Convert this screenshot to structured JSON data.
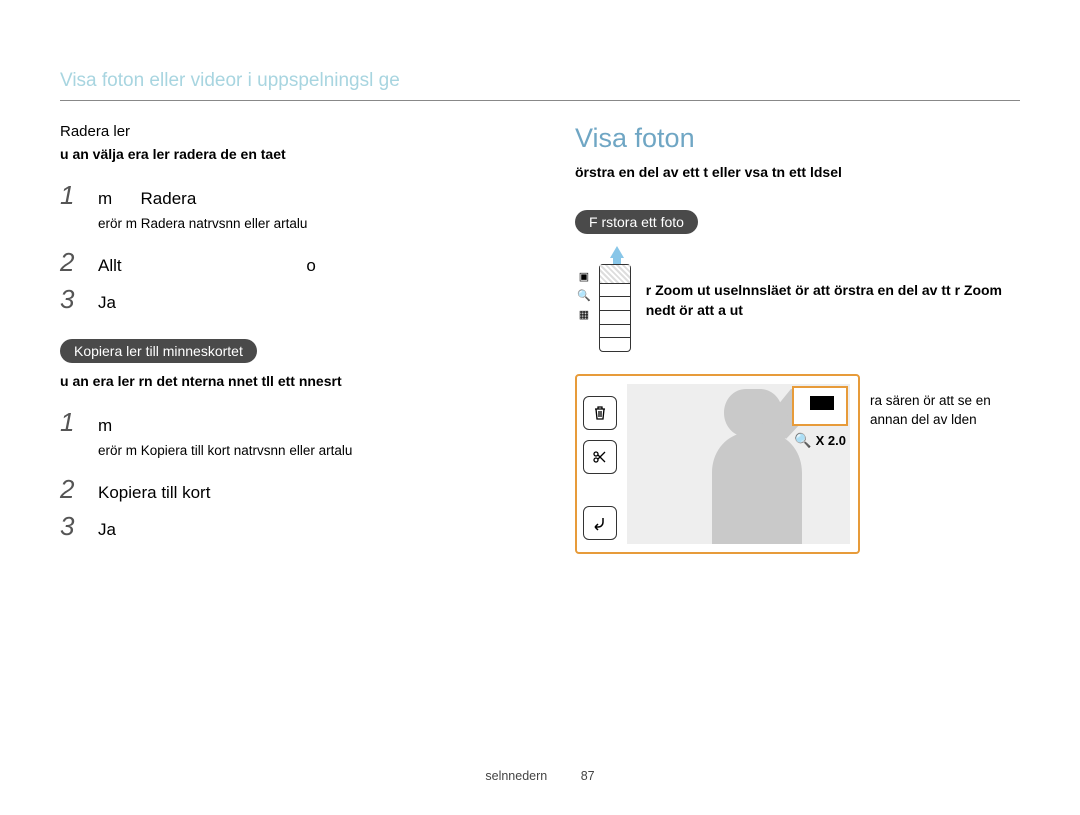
{
  "header": "Visa foton eller videor i uppspelningsl ge",
  "left": {
    "subhead": "Radera  ler",
    "desc": "u an välja era ler  radera de en  taet",
    "steps1": [
      {
        "num": "1",
        "text_pre": "m",
        "text_em": "Radera",
        "sub": "erör   m       Radera  natrvsnn eller artalu"
      },
      {
        "num": "2",
        "text": "Allt",
        "trail": "o"
      },
      {
        "num": "3",
        "text": "Ja"
      }
    ],
    "pill": "Kopiera  ler till minneskortet",
    "desc2": "u an era ler rn det nterna nnet tll ett nnesrt",
    "steps2": [
      {
        "num": "1",
        "text": "m",
        "sub": "erör   m       Kopiera till kort  natrvsnn eller artalu"
      },
      {
        "num": "2",
        "text": "Kopiera till kort"
      },
      {
        "num": "3",
        "text": "Ja"
      }
    ]
  },
  "right": {
    "title": "Visa foton",
    "desc": "örstra en del av ett t eller vsa tn  ett ldsel",
    "pill": "F rstora ett foto",
    "zoom_text": "r Zoom ut  uselnnsläet ör att örstra en del av tt r Zoom nedt ör att a ut",
    "zoom_val": "X 2.0",
    "callout": "ra sären ör att se en annan del av lden"
  },
  "footer": {
    "label": "selnnedern",
    "page": "87"
  }
}
